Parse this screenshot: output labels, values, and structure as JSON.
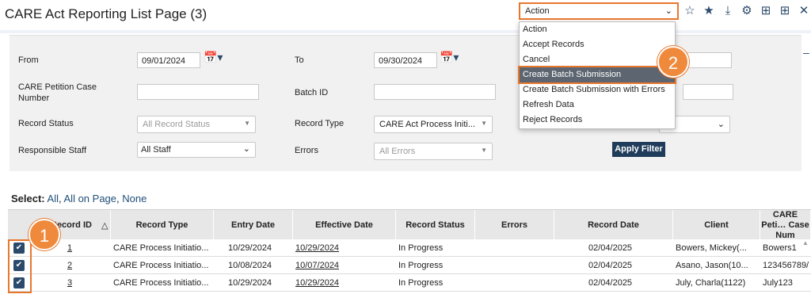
{
  "header": {
    "title": "CARE Act Reporting List Page (3)",
    "action_select": "Action",
    "icons": [
      "star-outline-icon",
      "star-icon",
      "download-icon",
      "gear-icon",
      "add-table-icon",
      "table-icon",
      "close-icon"
    ]
  },
  "dropdown": {
    "items": [
      "Action",
      "Accept Records",
      "Cancel",
      "Create Batch Submission",
      "Create Batch Submission with Errors",
      "Refresh Data",
      "Reject Records"
    ],
    "highlighted": "Create Batch Submission"
  },
  "filters": {
    "from_label": "From",
    "from_value": "09/01/2024",
    "to_label": "To",
    "to_value": "09/30/2024",
    "petition_label": "CARE Petition Case Number",
    "batch_label": "Batch ID",
    "status_label": "Record Status",
    "status_value": "All Record Status",
    "type_label": "Record Type",
    "type_value": "CARE Act Process Initi...",
    "staff_label": "Responsible Staff",
    "staff_value": "All Staff",
    "errors_label": "Errors",
    "errors_value": "All Errors",
    "apply_label": "Apply Filter"
  },
  "select": {
    "label": "Select:",
    "all": "All",
    "all_on_page": "All on Page",
    "none": "None"
  },
  "badges": {
    "one": "1",
    "two": "2"
  },
  "table": {
    "headers": {
      "record_id": "Record ID",
      "sort_icon": "△",
      "record_type": "Record Type",
      "entry_date": "Entry Date",
      "effective_date": "Effective Date",
      "record_status": "Record Status",
      "errors": "Errors",
      "record_date": "Record Date",
      "client": "Client",
      "care_case": "CARE Peti… Case Num"
    },
    "rows": [
      {
        "id": "1",
        "type": "CARE Process Initiatio...",
        "entry": "10/29/2024",
        "effective": "10/29/2024",
        "status": "In Progress",
        "errors": "",
        "record_date": "02/04/2025",
        "client": "Bowers, Mickey(...",
        "case": "Bowers1"
      },
      {
        "id": "2",
        "type": "CARE Process Initiatio...",
        "entry": "10/08/2024",
        "effective": "10/07/2024",
        "status": "In Progress",
        "errors": "",
        "record_date": "02/04/2025",
        "client": "Asano, Jason(10...",
        "case": "123456789/"
      },
      {
        "id": "3",
        "type": "CARE Process Initiatio...",
        "entry": "10/29/2024",
        "effective": "10/29/2024",
        "status": "In Progress",
        "errors": "",
        "record_date": "02/04/2025",
        "client": "July, Charla(1122)",
        "case": "July123"
      }
    ]
  },
  "colors": {
    "accent": "#e8772e",
    "navy": "#1f3c5a",
    "highlight": "#5d6670"
  }
}
